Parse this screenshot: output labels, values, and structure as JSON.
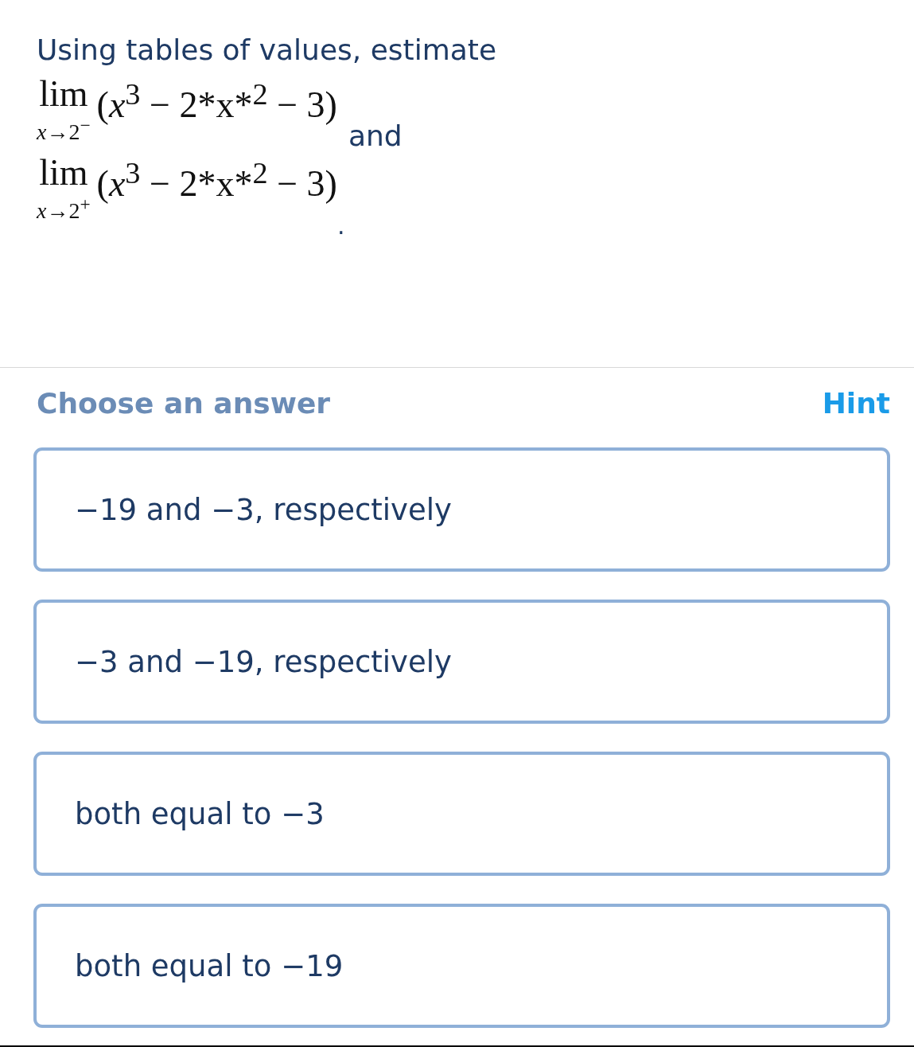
{
  "question": {
    "intro": "Using tables of values, estimate",
    "limits": [
      {
        "operator": "lim",
        "subscript": "*x*→2$^{−}$",
        "expression": "(*x*$^{3}$ − 2*x*$^{2}$ − 3)"
      },
      {
        "operator": "lim",
        "subscript": "*x*→2$^{+}$",
        "expression": "(*x*$^{3}$ − 2*x*$^{2}$ − 3)"
      }
    ],
    "connector": "and",
    "end": "."
  },
  "answers": {
    "heading": "Choose an answer",
    "hint": "Hint",
    "choices": [
      {
        "text": "−19 and −3, respectively"
      },
      {
        "text": "−3 and −19, respectively"
      },
      {
        "text": "both equal to −3"
      },
      {
        "text": "both equal to −19"
      }
    ]
  }
}
